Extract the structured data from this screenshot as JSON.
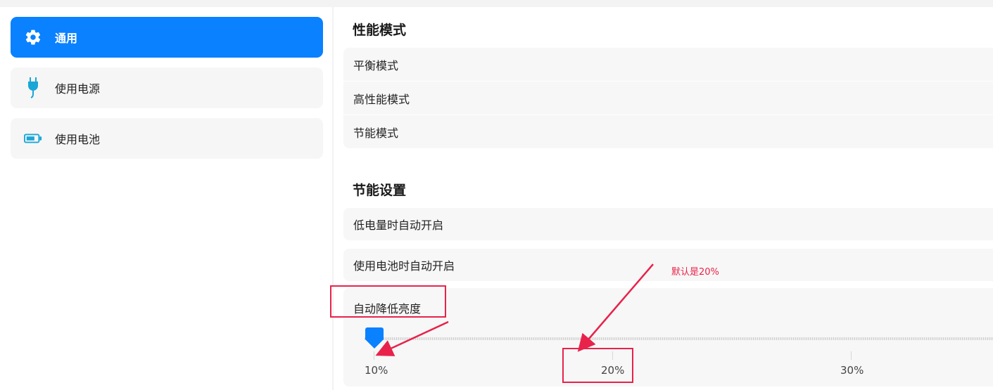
{
  "sidebar": {
    "items": [
      {
        "label": "通用",
        "icon": "gear-icon",
        "active": true
      },
      {
        "label": "使用电源",
        "icon": "plug-icon",
        "active": false
      },
      {
        "label": "使用电池",
        "icon": "battery-icon",
        "active": false
      }
    ]
  },
  "performance": {
    "title": "性能模式",
    "modes": [
      "平衡模式",
      "高性能模式",
      "节能模式"
    ]
  },
  "power_saving": {
    "title": "节能设置",
    "low_battery_auto": "低电量时自动开启",
    "on_battery_auto": "使用电池时自动开启",
    "auto_reduce_brightness": "自动降低亮度",
    "slider": {
      "value_percent": 10,
      "ticks": [
        "10%",
        "20%",
        "30%"
      ]
    }
  },
  "annotation": {
    "note": "默认是20%"
  },
  "colors": {
    "accent": "#0a81ff",
    "annotation": "#e8224a"
  }
}
